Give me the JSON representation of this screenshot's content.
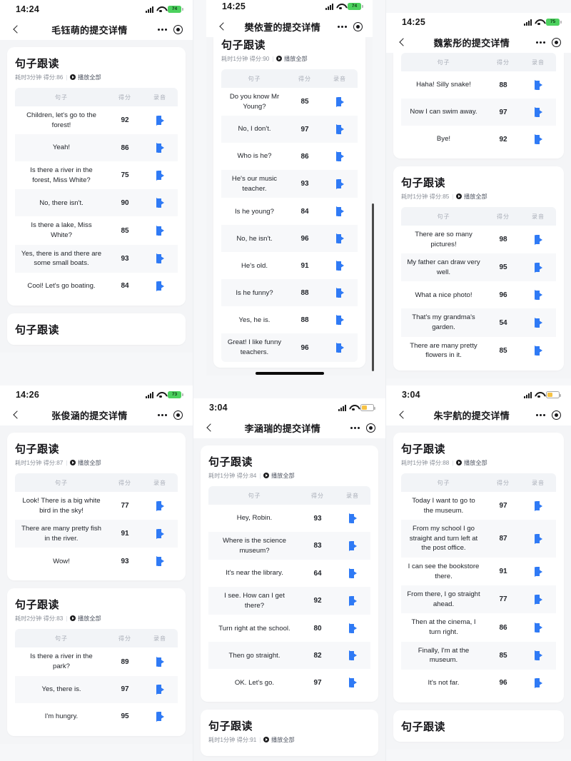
{
  "icons": {
    "back": "chevron-left-icon",
    "more": "more-dots-icon",
    "target": "target-icon",
    "play": "play-triangle-icon",
    "play_all": "play-circle-icon",
    "signal": "cellular-signal-icon",
    "wifi": "wifi-icon",
    "battery": "battery-icon"
  },
  "colors": {
    "accent_blue": "#2f7af5",
    "page_bg": "#f4f5f7",
    "card_bg": "#ffffff",
    "header_bg": "#f2f4f7",
    "battery_green": "#4cd15e",
    "battery_amber": "#f6c244",
    "text_primary": "#22252b",
    "text_muted": "#8a8f98"
  },
  "table_headers": {
    "sentence": "句子",
    "score": "得分",
    "recording": "录音"
  },
  "card_labels": {
    "title": "句子跟读",
    "play_all": "播放全部",
    "separator": "|"
  },
  "panels": [
    {
      "id": "panel-1",
      "status": {
        "time": "14:24",
        "battery": "74",
        "battery_style": "green"
      },
      "nav_title": "毛钰萌的提交详情",
      "cards": [
        {
          "title": "句子跟读",
          "meta": "耗时3分钟 得分:86",
          "play_all": "播放全部",
          "rows": [
            {
              "sentence": "Children, let's go to the forest!",
              "score": "92"
            },
            {
              "sentence": "Yeah!",
              "score": "86"
            },
            {
              "sentence": "Is there a river in the forest, Miss White?",
              "score": "75"
            },
            {
              "sentence": "No, there isn't.",
              "score": "90"
            },
            {
              "sentence": "Is there a lake, Miss White?",
              "score": "85"
            },
            {
              "sentence": "Yes, there is and there are some small boats.",
              "score": "93"
            },
            {
              "sentence": "Cool! Let's go boating.",
              "score": "84"
            }
          ]
        },
        {
          "title": "句子跟读",
          "meta": "",
          "play_all": "",
          "rows": []
        }
      ]
    },
    {
      "id": "panel-2",
      "status": {
        "time": "14:25",
        "battery": "74",
        "battery_style": "green"
      },
      "nav_title": "樊依萱的提交详情",
      "cards": [
        {
          "title": "句子跟读",
          "meta": "耗时1分钟 得分:90",
          "play_all": "播放全部",
          "rows": [
            {
              "sentence": "Do you know Mr Young?",
              "score": "85"
            },
            {
              "sentence": "No, I don't.",
              "score": "97"
            },
            {
              "sentence": "Who is he?",
              "score": "86"
            },
            {
              "sentence": "He's our music teacher.",
              "score": "93"
            },
            {
              "sentence": "Is he young?",
              "score": "84"
            },
            {
              "sentence": "No, he isn't.",
              "score": "96"
            },
            {
              "sentence": "He's old.",
              "score": "91"
            },
            {
              "sentence": "Is he funny?",
              "score": "88"
            },
            {
              "sentence": "Yes, he is.",
              "score": "88"
            },
            {
              "sentence": "Great! I like funny teachers.",
              "score": "96"
            }
          ]
        }
      ]
    },
    {
      "id": "panel-3",
      "status": {
        "time": "14:25",
        "battery": "75",
        "battery_style": "green"
      },
      "nav_title": "魏紫彤的提交详情",
      "cards": [
        {
          "title": "",
          "meta": "",
          "play_all": "",
          "rows": [
            {
              "sentence": "Haha! Silly snake!",
              "score": "88"
            },
            {
              "sentence": "Now I can swim away.",
              "score": "97"
            },
            {
              "sentence": "Bye!",
              "score": "92"
            }
          ]
        },
        {
          "title": "句子跟读",
          "meta": "耗时1分钟 得分:85",
          "play_all": "播放全部",
          "rows": [
            {
              "sentence": "There are so many pictures!",
              "score": "98"
            },
            {
              "sentence": "My father can draw very well.",
              "score": "95"
            },
            {
              "sentence": "What a nice photo!",
              "score": "96"
            },
            {
              "sentence": "That's my grandma's garden.",
              "score": "54"
            },
            {
              "sentence": "There are many pretty flowers in it.",
              "score": "85"
            }
          ]
        }
      ]
    },
    {
      "id": "panel-4",
      "status": {
        "time": "14:26",
        "battery": "73",
        "battery_style": "green"
      },
      "nav_title": "张俊涵的提交详情",
      "cards": [
        {
          "title": "句子跟读",
          "meta": "耗时1分钟 得分:87",
          "play_all": "播放全部",
          "rows": [
            {
              "sentence": "Look! There is a big white bird in the sky!",
              "score": "77"
            },
            {
              "sentence": "There are many pretty fish in the river.",
              "score": "91"
            },
            {
              "sentence": "Wow!",
              "score": "93"
            }
          ]
        },
        {
          "title": "句子跟读",
          "meta": "耗时2分钟 得分:83",
          "play_all": "播放全部",
          "rows": [
            {
              "sentence": "Is there a river in the park?",
              "score": "89"
            },
            {
              "sentence": "Yes, there is.",
              "score": "97"
            },
            {
              "sentence": "I'm hungry.",
              "score": "95"
            }
          ]
        }
      ]
    },
    {
      "id": "panel-5",
      "status": {
        "time": "3:04",
        "battery": "",
        "battery_style": "low"
      },
      "nav_title": "李涵瑞的提交详情",
      "cards": [
        {
          "title": "句子跟读",
          "meta": "耗时1分钟 得分:84",
          "play_all": "播放全部",
          "rows": [
            {
              "sentence": "Hey, Robin.",
              "score": "93"
            },
            {
              "sentence": "Where is the science museum?",
              "score": "83"
            },
            {
              "sentence": "It's near the library.",
              "score": "64"
            },
            {
              "sentence": "I see. How can I get there?",
              "score": "92"
            },
            {
              "sentence": "Turn right at the school.",
              "score": "80"
            },
            {
              "sentence": "Then go straight.",
              "score": "82"
            },
            {
              "sentence": "OK. Let's go.",
              "score": "97"
            }
          ]
        },
        {
          "title": "句子跟读",
          "meta": "耗时1分钟 得分:91",
          "play_all": "播放全部",
          "rows": []
        }
      ]
    },
    {
      "id": "panel-6",
      "status": {
        "time": "3:04",
        "battery": "",
        "battery_style": "low"
      },
      "nav_title": "朱宇航的提交详情",
      "cards": [
        {
          "title": "句子跟读",
          "meta": "耗时1分钟 得分:88",
          "play_all": "播放全部",
          "rows": [
            {
              "sentence": "Today I want to go to the museum.",
              "score": "97"
            },
            {
              "sentence": "From my school I go straight and turn left at the post office.",
              "score": "87"
            },
            {
              "sentence": "I can see the bookstore there.",
              "score": "91"
            },
            {
              "sentence": "From there, I go straight ahead.",
              "score": "77"
            },
            {
              "sentence": "Then at the cinema, I turn right.",
              "score": "86"
            },
            {
              "sentence": "Finally, I'm at the museum.",
              "score": "85"
            },
            {
              "sentence": "It's not far.",
              "score": "96"
            }
          ]
        },
        {
          "title": "句子跟读",
          "meta": "",
          "play_all": "",
          "rows": []
        }
      ]
    }
  ]
}
